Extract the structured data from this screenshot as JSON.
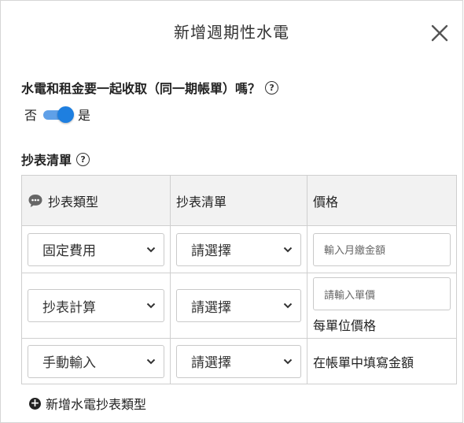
{
  "dialog": {
    "title": "新增週期性水電"
  },
  "question": {
    "label": "水電和租金要一起收取（同一期帳單）嗎？",
    "toggle_off_label": "否",
    "toggle_on_label": "是",
    "toggle_state": "on"
  },
  "meter_section": {
    "label": "抄表清單",
    "headers": [
      "抄表類型",
      "抄表清單",
      "價格"
    ],
    "rows": [
      {
        "type": "固定費用",
        "list": "請選擇",
        "price_placeholder": "輸入月繳金額",
        "price_note": ""
      },
      {
        "type": "抄表計算",
        "list": "請選擇",
        "price_placeholder": "請輸入單價",
        "price_note": "每單位價格"
      },
      {
        "type": "手動輸入",
        "list": "請選擇",
        "price_placeholder": "",
        "price_note": "在帳單中填寫金額"
      }
    ],
    "add_label": "新增水電抄表類型"
  },
  "colors": {
    "accent": "#1e7fe0",
    "header_bg": "#f2f2f2",
    "border": "#cfcfcf"
  }
}
